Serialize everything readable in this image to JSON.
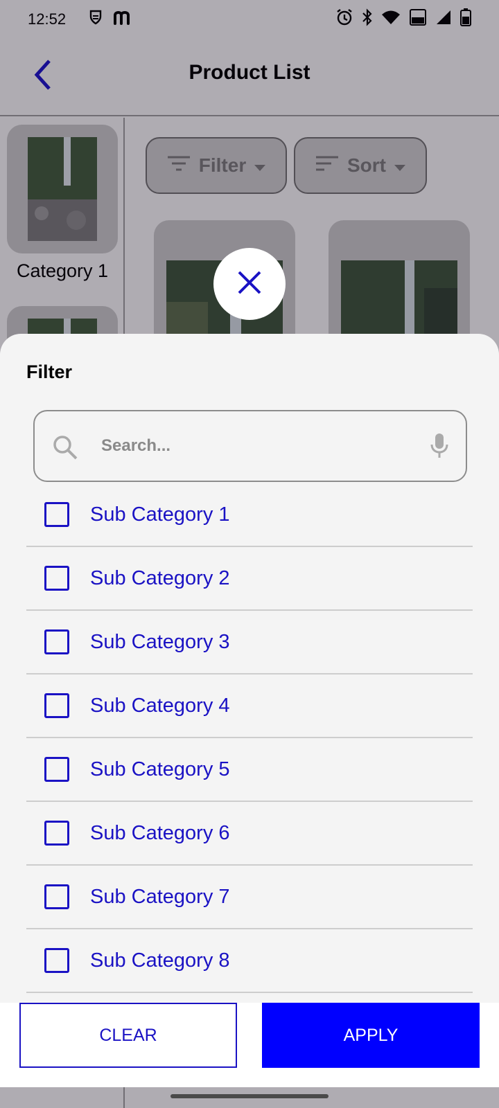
{
  "status_bar": {
    "time": "12:52",
    "icons": [
      "shield-icon",
      "m-logo-icon",
      "alarm-icon",
      "bluetooth-icon",
      "wifi-icon",
      "volte-icon",
      "signal-icon",
      "battery-icon"
    ]
  },
  "app_bar": {
    "title": "Product List",
    "back_icon": "chevron-left-icon"
  },
  "left_rail": {
    "categories": [
      {
        "label": "Category 1"
      }
    ]
  },
  "toolbar": {
    "filter_label": "Filter",
    "sort_label": "Sort"
  },
  "filter_sheet": {
    "title": "Filter",
    "search": {
      "placeholder": "Search...",
      "value": ""
    },
    "items": [
      {
        "label": "Sub Category 1",
        "checked": false
      },
      {
        "label": "Sub Category 2",
        "checked": false
      },
      {
        "label": "Sub Category 3",
        "checked": false
      },
      {
        "label": "Sub Category 4",
        "checked": false
      },
      {
        "label": "Sub Category 5",
        "checked": false
      },
      {
        "label": "Sub Category 6",
        "checked": false
      },
      {
        "label": "Sub Category 7",
        "checked": false
      },
      {
        "label": "Sub Category 8",
        "checked": false
      }
    ],
    "clear_label": "CLEAR",
    "apply_label": "APPLY"
  },
  "colors": {
    "accent": "#1a12c4",
    "apply_bg": "#0000ff",
    "sheet_bg": "#f4f4f4"
  }
}
